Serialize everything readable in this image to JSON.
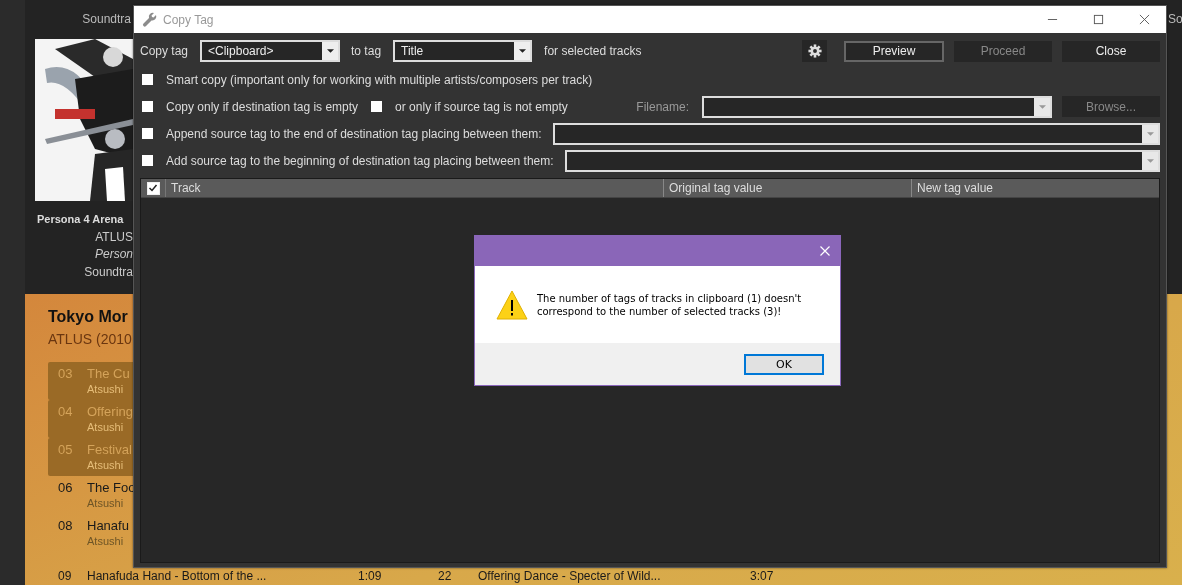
{
  "background_app": {
    "album_tiles": [
      {
        "genre": "Soundtra"
      },
      {
        "genre": "So"
      }
    ],
    "album": {
      "title": "Persona 4 Arena",
      "artist": "ATLUS",
      "series": "Person",
      "genre": "Soundtra"
    },
    "album_panel": {
      "title": "Tokyo Mor",
      "subtitle": "ATLUS (2010",
      "tracks": [
        {
          "number": "03",
          "title": "The Cu",
          "artist": "Atsushi",
          "selected": true
        },
        {
          "number": "04",
          "title": "Offering",
          "artist": "Atsushi",
          "selected": true
        },
        {
          "number": "05",
          "title": "Festival",
          "artist": "Atsushi",
          "selected": true
        },
        {
          "number": "06",
          "title": "The Foo",
          "artist": "Atsushi",
          "selected": false
        },
        {
          "number": "08",
          "title": "Hanafu",
          "artist": "Atsushi",
          "selected": false
        }
      ],
      "last_row": {
        "number": "09",
        "title": "Hanafuda Hand - Bottom of the ...",
        "duration": "1:09",
        "number_2": "22",
        "title_2": "Offering Dance - Specter of Wild...",
        "duration_2": "3:07"
      }
    }
  },
  "dialog": {
    "title": "Copy Tag",
    "copy_tag_label": "Copy tag",
    "source": "<Clipboard>",
    "to_tag_label": "to tag",
    "destination": "Title",
    "suffix": "for selected tracks",
    "buttons": [
      {
        "label": "Preview",
        "disabled": false,
        "default": true
      },
      {
        "label": "Proceed",
        "disabled": true,
        "default": false
      },
      {
        "label": "Close",
        "disabled": false,
        "default": false
      }
    ],
    "smart_copy": {
      "label": "Smart copy (important only for working with multiple artists/composers per track)",
      "checked": false
    },
    "only_if_empty": {
      "label": "Copy only if destination tag is empty",
      "checked": false
    },
    "only_if_source": {
      "label": "or only if source tag is not empty",
      "checked": false
    },
    "filename_label": "Filename:",
    "browse": {
      "label": "Browse...",
      "disabled": true
    },
    "append": {
      "label": "Append source tag to the end of destination tag placing between them:",
      "checked": false
    },
    "prepend": {
      "label": "Add source tag to the beginning of destination tag placing between them:",
      "checked": false
    },
    "table": {
      "all_checked": true,
      "columns": [
        "Track",
        "Original tag value",
        "New tag value"
      ]
    }
  },
  "message_box": {
    "text": "The number of tags of tracks in clipboard (1) doesn't correspond to the number of selected tracks (3)!",
    "ok": {
      "label": "OK",
      "focused": true
    }
  }
}
